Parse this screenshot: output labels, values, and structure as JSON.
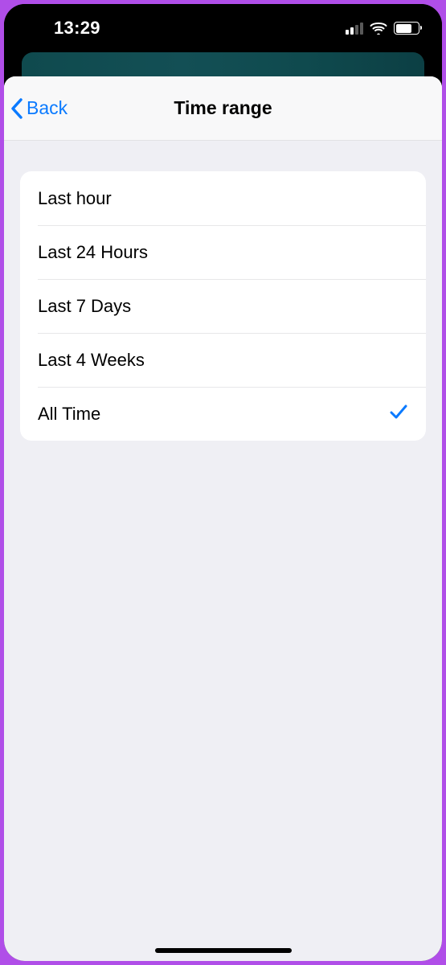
{
  "statusbar": {
    "time": "13:29"
  },
  "nav": {
    "back_label": "Back",
    "title": "Time range"
  },
  "options": [
    {
      "label": "Last hour",
      "selected": false
    },
    {
      "label": "Last 24 Hours",
      "selected": false
    },
    {
      "label": "Last 7 Days",
      "selected": false
    },
    {
      "label": "Last 4 Weeks",
      "selected": false
    },
    {
      "label": "All Time",
      "selected": true
    }
  ]
}
